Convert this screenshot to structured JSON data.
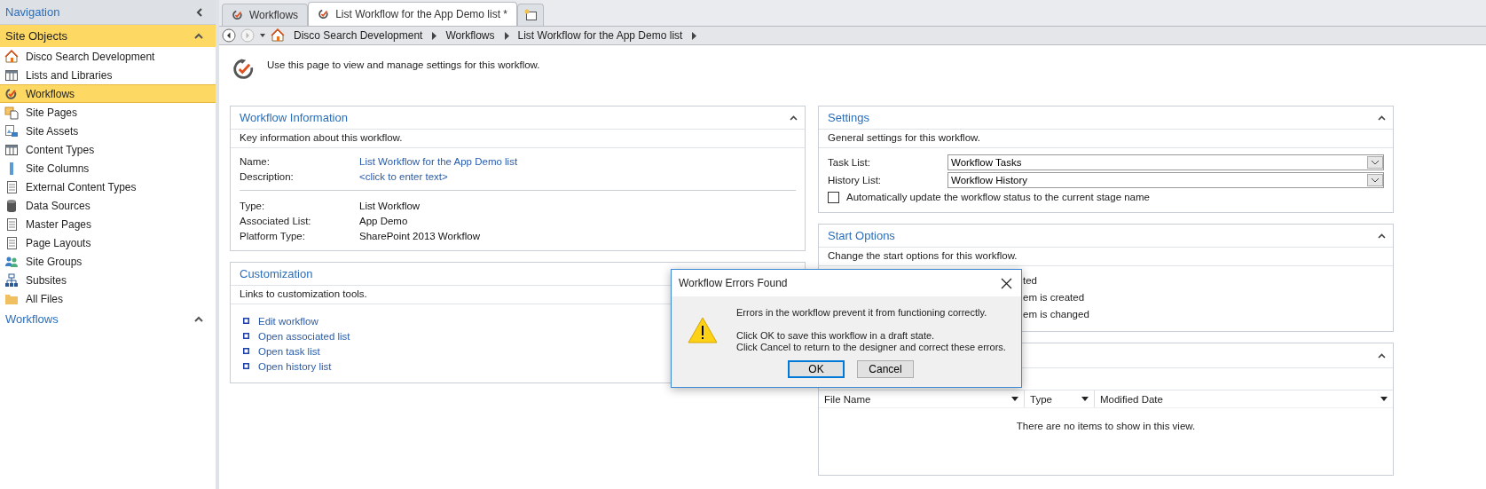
{
  "sidebar": {
    "title": "Navigation",
    "sections": [
      {
        "title": "Site Objects",
        "selected": true,
        "expanded": true,
        "items": [
          {
            "label": "Disco Search Development",
            "kind": "home",
            "selected": false
          },
          {
            "label": "Lists and Libraries",
            "kind": "table",
            "selected": false
          },
          {
            "label": "Workflows",
            "kind": "workflow",
            "selected": true
          },
          {
            "label": "Site Pages",
            "kind": "pages",
            "selected": false
          },
          {
            "label": "Site Assets",
            "kind": "assets",
            "selected": false
          },
          {
            "label": "Content Types",
            "kind": "table",
            "selected": false
          },
          {
            "label": "Site Columns",
            "kind": "column",
            "selected": false
          },
          {
            "label": "External Content Types",
            "kind": "document",
            "selected": false
          },
          {
            "label": "Data Sources",
            "kind": "database",
            "selected": false
          },
          {
            "label": "Master Pages",
            "kind": "document",
            "selected": false
          },
          {
            "label": "Page Layouts",
            "kind": "document",
            "selected": false
          },
          {
            "label": "Site Groups",
            "kind": "people",
            "selected": false
          },
          {
            "label": "Subsites",
            "kind": "hierarchy",
            "selected": false
          },
          {
            "label": "All Files",
            "kind": "folder",
            "selected": false
          }
        ]
      },
      {
        "title": "Workflows",
        "selected": false,
        "expanded": true
      }
    ]
  },
  "tabs": [
    {
      "label": "Workflows",
      "selected": false
    },
    {
      "label": "List Workflow for the App Demo list *",
      "selected": true
    }
  ],
  "breadcrumb": [
    "Disco Search Development",
    "Workflows",
    "List Workflow for the App Demo list"
  ],
  "intro": "Use this page to view and manage settings for this workflow.",
  "workflow_information": {
    "title": "Workflow Information",
    "description": "Key information about this workflow.",
    "general": [
      {
        "label": "Name:",
        "value": "List Workflow for the App Demo list"
      },
      {
        "label": "Description:",
        "value": "<click to enter text>"
      }
    ],
    "details": [
      {
        "label": "Type:",
        "value": "List Workflow"
      },
      {
        "label": "Associated List:",
        "value": "App Demo"
      },
      {
        "label": "Platform Type:",
        "value": "SharePoint 2013 Workflow"
      }
    ]
  },
  "customization": {
    "title": "Customization",
    "description": "Links to customization tools.",
    "links": [
      "Edit workflow",
      "Open associated list",
      "Open task list",
      "Open history list"
    ]
  },
  "settings": {
    "title": "Settings",
    "description": "General settings for this workflow.",
    "fields": [
      {
        "label": "Task List:",
        "value": "Workflow Tasks"
      },
      {
        "label": "History List:",
        "value": "Workflow History"
      }
    ],
    "checkbox": {
      "label": "Automatically update the workflow status to the current stage name",
      "checked": false
    }
  },
  "start_options": {
    "title": "Start Options",
    "description": "Change the start options for this workflow.",
    "options": [
      "ted",
      "em is created",
      "em is changed"
    ]
  },
  "files": {
    "columns": [
      "File Name",
      "Type",
      "Modified Date"
    ],
    "empty": "There are no items to show in this view."
  },
  "dialog": {
    "title": "Workflow Errors Found",
    "message": "Errors in the workflow prevent it from functioning correctly.",
    "details": [
      "Click OK to save this workflow in a draft state.",
      "Click Cancel to return to the designer and correct these errors."
    ],
    "buttons": [
      {
        "label": "OK",
        "default": true
      },
      {
        "label": "Cancel",
        "default": false
      }
    ]
  }
}
